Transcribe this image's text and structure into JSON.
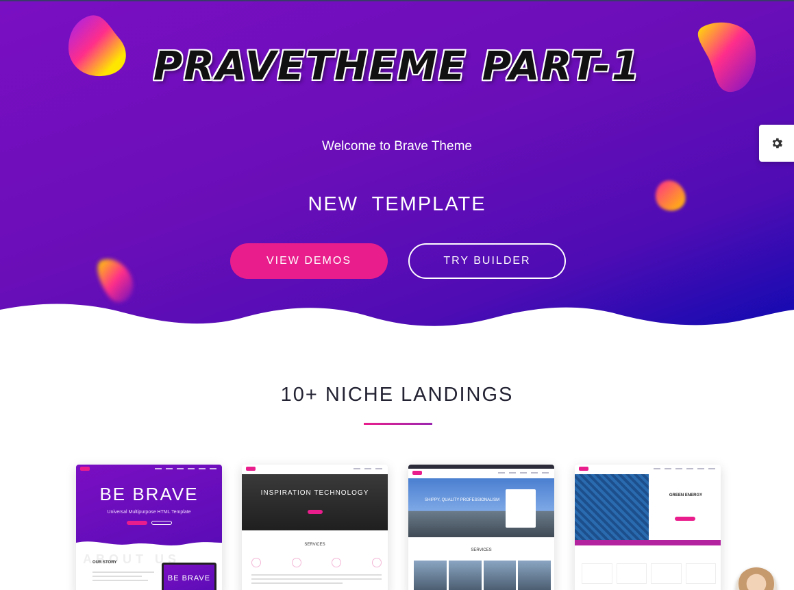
{
  "hero": {
    "title": "PRAVETHEME PART-1",
    "welcome": "Welcome to Brave Theme",
    "tagline": "NEW  TEMPLATE",
    "primary_button": "VIEW DEMOS",
    "secondary_button": "TRY BUILDER"
  },
  "settings": {
    "icon": "gear-icon"
  },
  "section": {
    "title": "10+ NICHE LANDINGS"
  },
  "cards": [
    {
      "headline": "BE BRAVE",
      "subline": "Universal Multipurpose HTML Template",
      "about": "ABOUT US",
      "story": "OUR STORY",
      "laptop": "BE BRAVE"
    },
    {
      "headline": "INSPIRATION TECHNOLOGY",
      "services": "SERVICES"
    },
    {
      "headline": "SHIPPY, QUALITY PROFESSIONALISM",
      "services": "SERVICES"
    },
    {
      "headline": "GREEN ENERGY"
    }
  ],
  "colors": {
    "accent": "#e91e8c",
    "hero_start": "#7a0fc2",
    "hero_end": "#0a0ab0"
  }
}
